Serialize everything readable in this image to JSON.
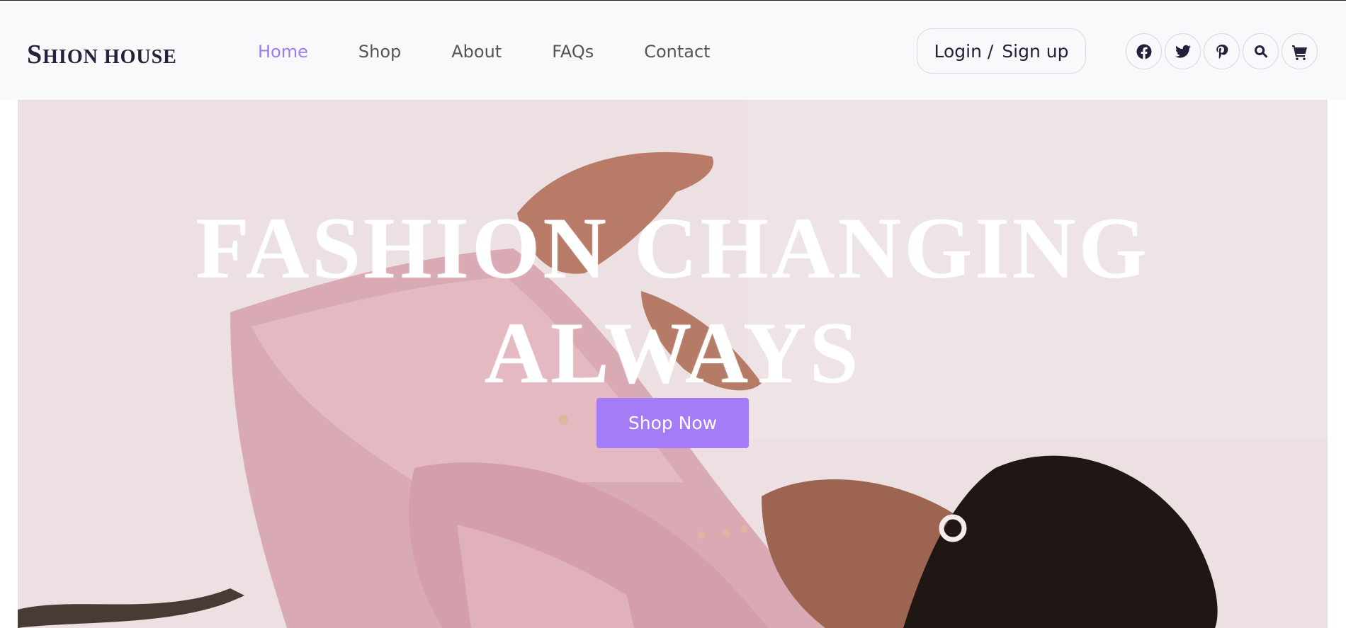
{
  "brand": {
    "name_first": "S",
    "name_rest": "HION HOUSE"
  },
  "nav": {
    "items": [
      {
        "label": "Home",
        "active": true
      },
      {
        "label": "Shop",
        "active": false
      },
      {
        "label": "About",
        "active": false
      },
      {
        "label": "FAQs",
        "active": false
      },
      {
        "label": "Contact",
        "active": false
      }
    ]
  },
  "auth": {
    "login_label": "Login /",
    "signup_label": "Sign up"
  },
  "header_icons": [
    "facebook-icon",
    "twitter-icon",
    "pinterest-icon",
    "search-icon",
    "cart-icon"
  ],
  "hero": {
    "headline_line1": "FASHION CHANGING",
    "headline_line2": "ALWAYS",
    "cta_label": "Shop Now"
  },
  "colors": {
    "accent": "#a47cf7",
    "nav_active": "#9b7cf4",
    "text_dark": "#22223b",
    "header_bg": "#f8f9fa"
  }
}
